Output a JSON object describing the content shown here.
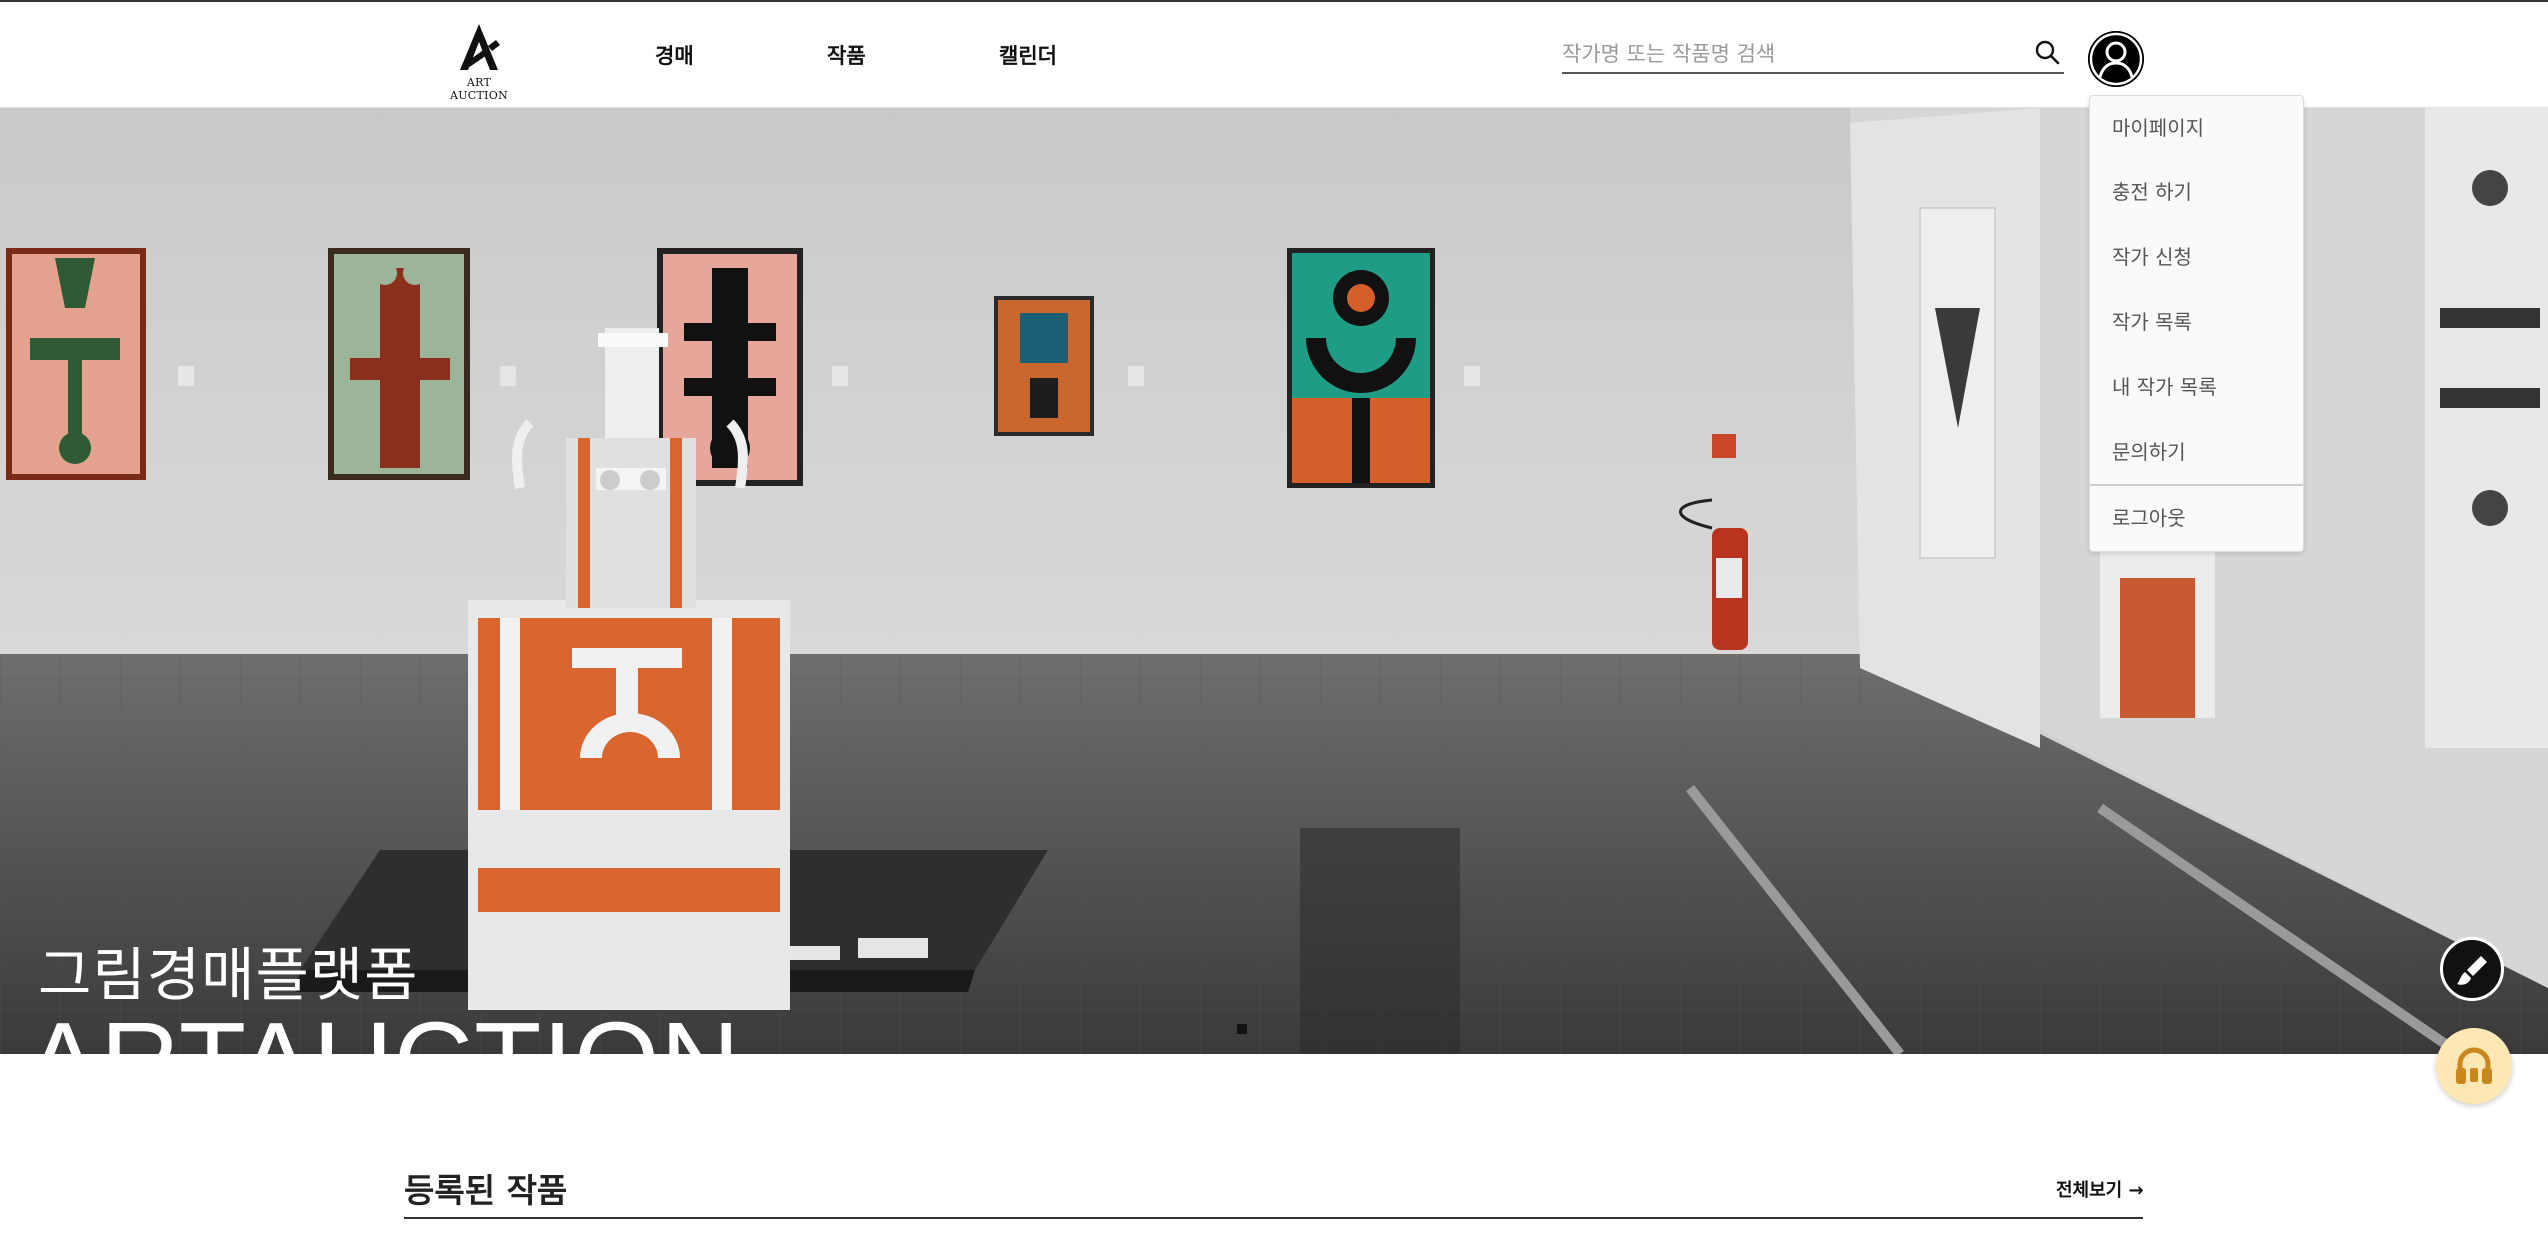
{
  "header": {
    "logo_text": "ART AUCTION",
    "nav": [
      {
        "label": "경매"
      },
      {
        "label": "작품"
      },
      {
        "label": "캘린더"
      }
    ],
    "search": {
      "placeholder": "작가명 또는 작품명 검색",
      "value": ""
    },
    "icons": {
      "search": "search-icon",
      "avatar": "user-avatar-icon"
    }
  },
  "user_menu": {
    "items": [
      {
        "label": "마이페이지"
      },
      {
        "label": "충전 하기"
      },
      {
        "label": "작가 신청"
      },
      {
        "label": "작가 목록"
      },
      {
        "label": "내 작가 목록"
      },
      {
        "label": "문의하기"
      },
      {
        "label": "로그아웃"
      }
    ]
  },
  "hero": {
    "subtitle": "그림경매플랫폼",
    "title": "ARTAUCTION",
    "slide_indicator": {
      "current": 1
    }
  },
  "floating": {
    "brush_icon": "paintbrush-icon",
    "support_icon": "headset-icon",
    "support_color": "#fde7b5"
  },
  "section": {
    "title": "등록된 작품",
    "view_all": "전체보기 →"
  },
  "colors": {
    "accent_orange": "#d9652f",
    "dark": "#111111"
  }
}
